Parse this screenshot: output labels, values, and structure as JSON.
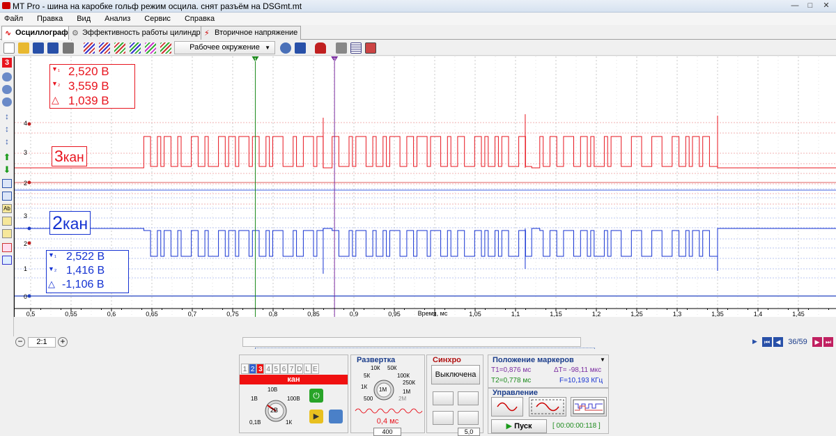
{
  "window": {
    "title": "MT Pro - шина на каробке  гольф режим осцила. снят разъём на DSGmt.mt"
  },
  "menu": [
    "Файл",
    "Правка",
    "Вид",
    "Анализ",
    "Сервис",
    "Справка"
  ],
  "tabs": [
    {
      "label": "Осциллограф",
      "active": true
    },
    {
      "label": "Эффективность работы цилиндров",
      "active": false
    },
    {
      "label": "Вторичное напряжение",
      "active": false
    }
  ],
  "toolbar": {
    "env_dropdown": "Рабочее окружение"
  },
  "sidebar": {
    "channel_num": "3"
  },
  "plot": {
    "ch3": {
      "label_num": "3",
      "label_text": "кан",
      "t1": "2,520 В",
      "t2": "3,559 В",
      "delta": "1,039 В"
    },
    "ch2": {
      "label_num": "2",
      "label_text": "кан",
      "t1": "2,522 В",
      "t2": "1,416 В",
      "delta": "-1,106 В"
    },
    "y_ticks": [
      "4",
      "3",
      "2",
      "3",
      "2",
      "1",
      "0"
    ],
    "x_ticks": [
      "0,5",
      "0,55",
      "0,6",
      "0,65",
      "0,7",
      "0,75",
      "0,8",
      "0,85",
      "0,9",
      "0,95",
      "1",
      "1,05",
      "1,1",
      "1,15",
      "1,2",
      "1,25",
      "1,3",
      "1,35",
      "1,4",
      "1,45"
    ],
    "x_label": "Время, мс",
    "marker1": "1",
    "marker2": "2"
  },
  "scroll": {
    "zoom": "2:1",
    "page": "36/59"
  },
  "channel_panel": {
    "tabs": [
      "1",
      "2",
      "3",
      "4",
      "5",
      "6",
      "7",
      "D",
      "L",
      "E"
    ],
    "active_tab": "3",
    "title": "кан",
    "scale_labels": {
      "s10v": "10В",
      "s1v": "1В",
      "s100v": "100В",
      "s01v": "0,1В",
      "s1k": "1К",
      "center": "2В"
    }
  },
  "sweep": {
    "title": "Развертка",
    "scale": {
      "k10": "10К",
      "k50": "50К",
      "k5": "5К",
      "k100": "100К",
      "k250": "250К",
      "k1": "1К",
      "m1": "1М",
      "n500": "500",
      "m2": "2М",
      "center": "1М"
    },
    "value": "0,4 мс",
    "count": "400"
  },
  "sync": {
    "title": "Синхро",
    "state": "Выключена",
    "level": "5,0"
  },
  "markers": {
    "title": "Положение маркеров",
    "t1": "T1=0,876 мс",
    "dt": "ΔT= -98,11 мкс",
    "t2": "T2=0,778 мс",
    "f": "F=10,193 КГц"
  },
  "control": {
    "title": "Управление",
    "start": "Пуск",
    "timer": "[ 00:00:00:118 ]"
  },
  "colors": {
    "ch3": "#e8141e",
    "ch2": "#1432d2",
    "marker1": "#1c8a1c",
    "marker2": "#7a2ca0",
    "panel_red": "#f01010"
  }
}
